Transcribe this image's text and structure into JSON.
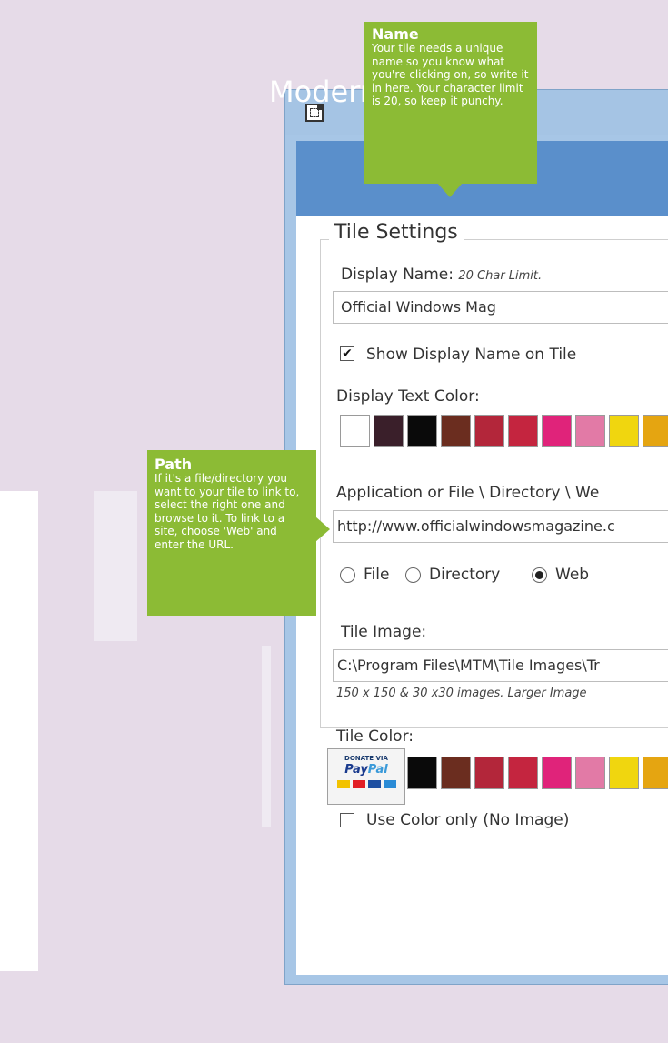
{
  "app": {
    "title": "Modern"
  },
  "tile_settings": {
    "legend": "Tile Settings",
    "display_name_label": "Display Name:",
    "display_name_hint": "20 Char Limit.",
    "display_name_value": "Official Windows Mag",
    "show_name_label": "Show Display Name on Tile",
    "show_name_checked": "✔",
    "display_text_color_label": "Display Text Color:",
    "path_label": "Application or File \\ Directory \\ We",
    "path_value": "http://www.officialwindowsmagazine.c",
    "radio_file": "File",
    "radio_directory": "Directory",
    "radio_web": "Web",
    "tile_image_label": "Tile Image:",
    "tile_image_value": "C:\\Program Files\\MTM\\Tile Images\\Tr",
    "tile_image_hint": "150 x 150 & 30 x30 images. Larger Image",
    "tile_color_label": "Tile Color:",
    "use_color_label": "Use Color only (No Image)"
  },
  "swatch_colors": [
    "#ffffff",
    "#3a1f2a",
    "#0a0a0a",
    "#6b2d1f",
    "#b3263a",
    "#c4253f",
    "#e0237a",
    "#e27aa6",
    "#f0d60f",
    "#e5a511"
  ],
  "paypal": {
    "top": "DONATE VIA",
    "logo_a": "Pay",
    "logo_b": "Pal"
  },
  "callouts": {
    "name": {
      "title": "Name",
      "body": "Your tile needs a unique name so you know what you're clicking on, so write it in here. Your character limit is 20, so keep it punchy."
    },
    "path": {
      "title": "Path",
      "body": "If it's a file/directory you want to your tile to link to, select the right one and browse to it. To link to a site, choose 'Web' and enter the URL."
    }
  }
}
